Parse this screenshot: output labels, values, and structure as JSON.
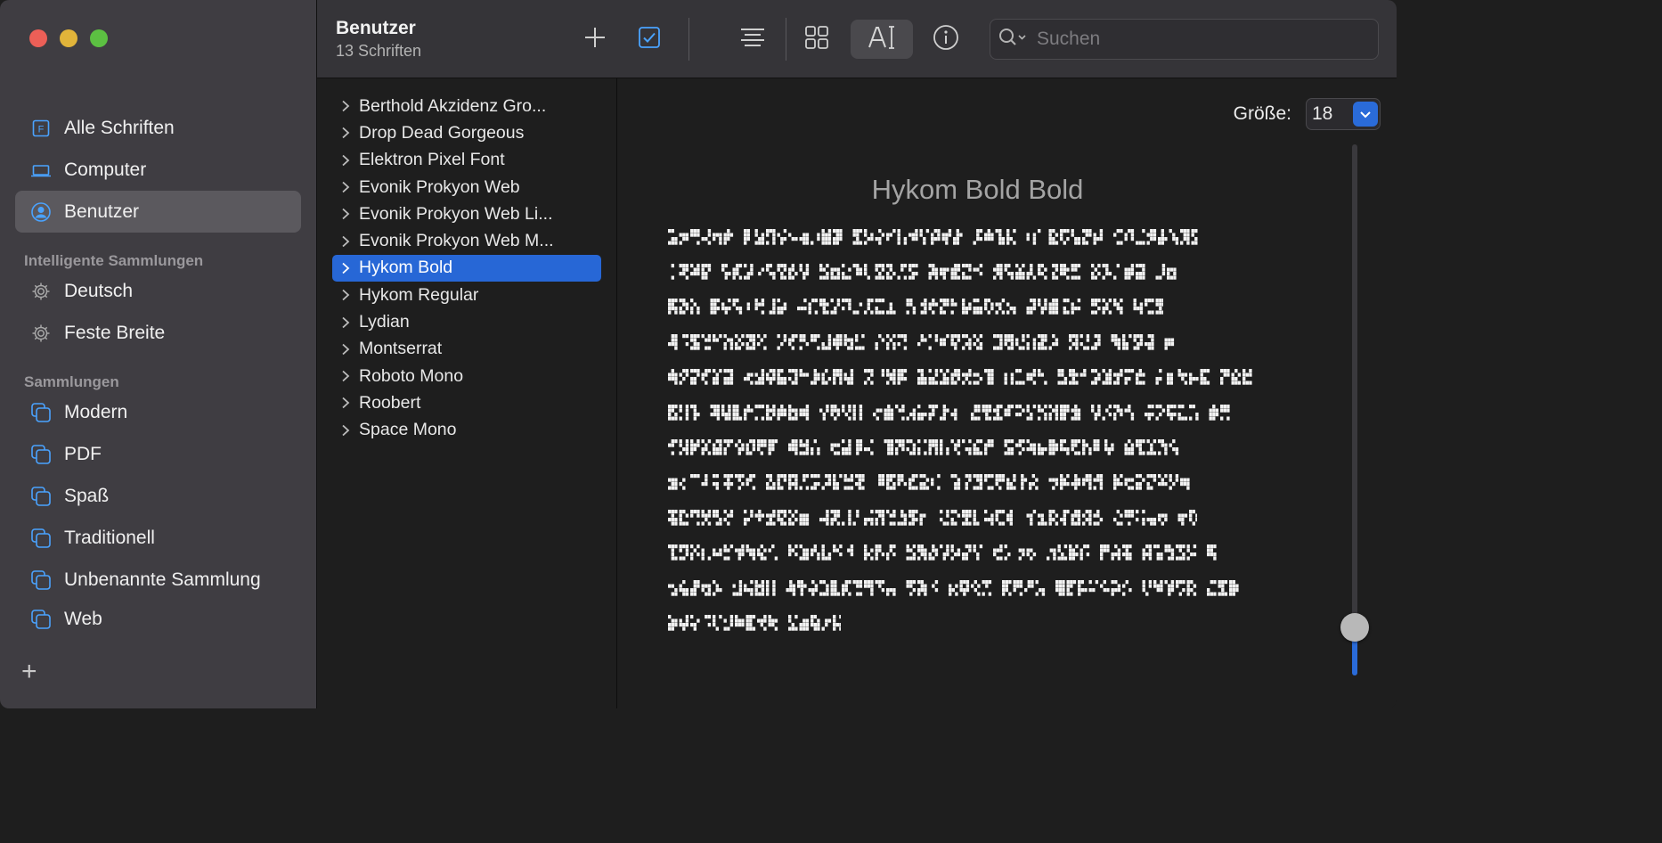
{
  "sidebar": {
    "main_items": [
      {
        "label": "Alle Schriften",
        "icon": "font-book-icon"
      },
      {
        "label": "Computer",
        "icon": "laptop-icon"
      },
      {
        "label": "Benutzer",
        "icon": "user-circle-icon",
        "selected": true
      }
    ],
    "smart_heading": "Intelligente Sammlungen",
    "smart_items": [
      {
        "label": "Deutsch",
        "icon": "gear-icon"
      },
      {
        "label": "Feste Breite",
        "icon": "gear-icon"
      }
    ],
    "collections_heading": "Sammlungen",
    "collections": [
      {
        "label": "Modern",
        "icon": "collection-icon"
      },
      {
        "label": "PDF",
        "icon": "collection-icon"
      },
      {
        "label": "Spaß",
        "icon": "collection-icon"
      },
      {
        "label": "Traditionell",
        "icon": "collection-icon"
      },
      {
        "label": "Unbenannte Sammlung",
        "icon": "collection-icon"
      },
      {
        "label": "Web",
        "icon": "collection-icon"
      }
    ],
    "add_label": "+"
  },
  "toolbar": {
    "title": "Benutzer",
    "subtitle": "13 Schriften",
    "search_placeholder": "Suchen"
  },
  "font_list": [
    "Berthold Akzidenz Gro...",
    "Drop Dead Gorgeous",
    "Elektron Pixel Font",
    "Evonik Prokyon Web",
    "Evonik Prokyon Web Li...",
    "Evonik Prokyon Web M...",
    "Hykom Bold",
    "Hykom Regular",
    "Lydian",
    "Montserrat",
    "Roboto Mono",
    "Roobert",
    "Space Mono"
  ],
  "selected_font": "Hykom Bold",
  "preview": {
    "size_label": "Größe:",
    "size_value": "18",
    "title": "Hykom Bold Bold",
    "slider_level": 0.04
  },
  "colors": {
    "accent": "#2767d6",
    "sidebar_bg": "#3f3d42",
    "toolbar_bg": "#353438",
    "content_bg": "#1e1e1e"
  }
}
